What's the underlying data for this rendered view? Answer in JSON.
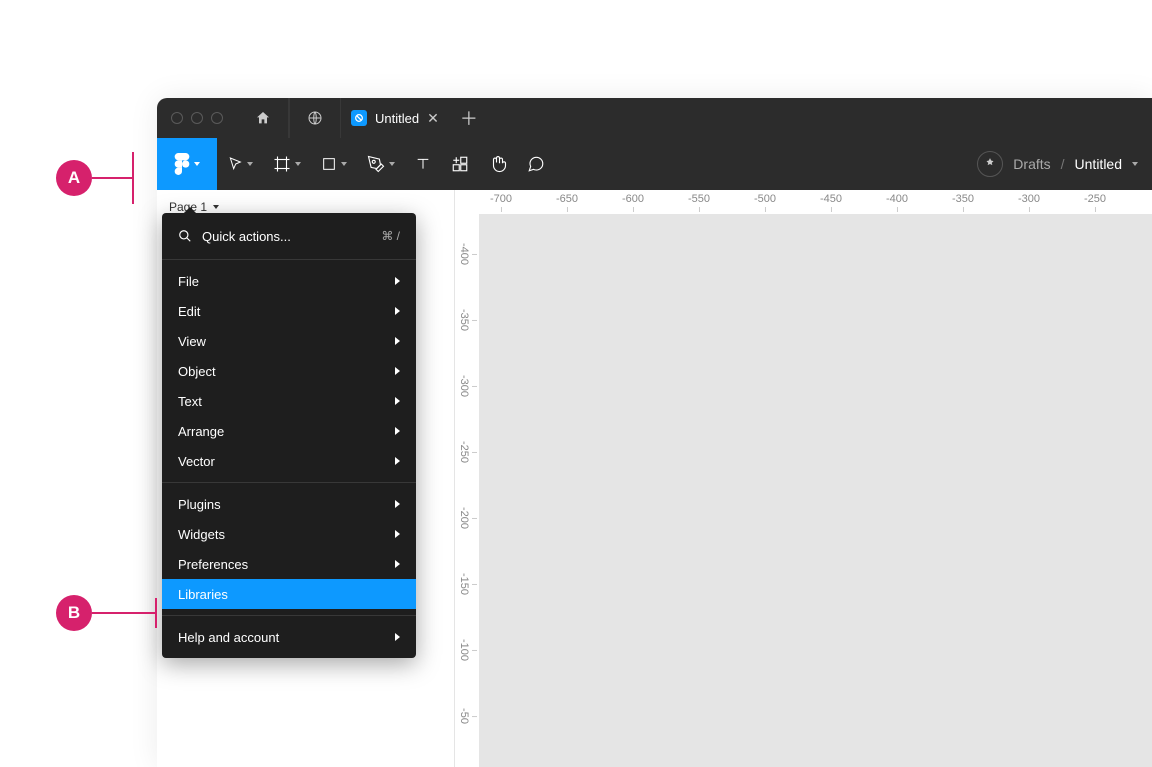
{
  "tabs": {
    "file_name": "Untitled"
  },
  "breadcrumb": {
    "location": "Drafts",
    "file": "Untitled"
  },
  "panel": {
    "page": "Page 1"
  },
  "ruler": {
    "top": [
      "-700",
      "-650",
      "-600",
      "-550",
      "-500",
      "-450",
      "-400",
      "-350",
      "-300",
      "-250"
    ],
    "left": [
      "-400",
      "-350",
      "-300",
      "-250",
      "-200",
      "-150",
      "-100",
      "-50"
    ]
  },
  "menu": {
    "quick_actions": "Quick actions...",
    "shortcut": "⌘ /",
    "group1": [
      "File",
      "Edit",
      "View",
      "Object",
      "Text",
      "Arrange",
      "Vector"
    ],
    "group2": [
      "Plugins",
      "Widgets",
      "Preferences",
      "Libraries"
    ],
    "group3": [
      "Help and account"
    ],
    "highlighted": "Libraries"
  },
  "callouts": {
    "a": "A",
    "b": "B"
  }
}
